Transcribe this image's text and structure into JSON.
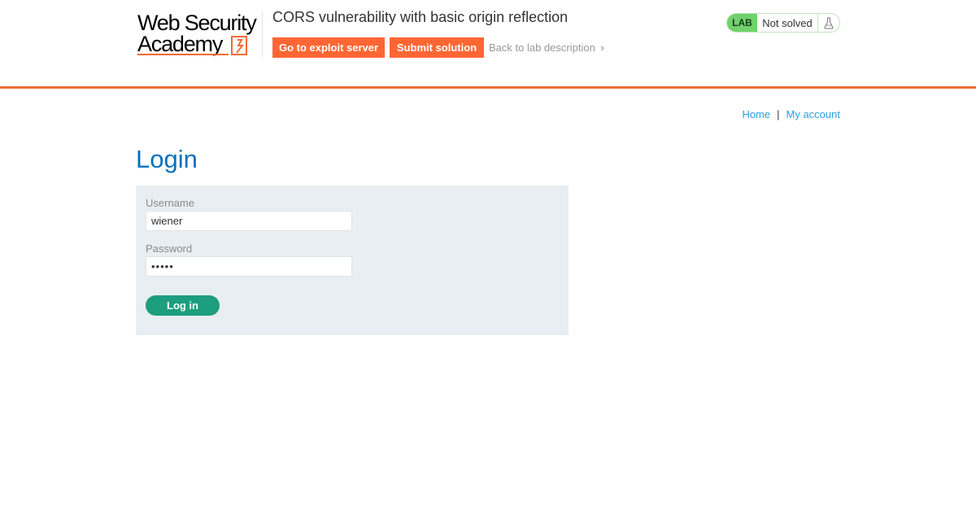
{
  "header": {
    "logo": {
      "line1": "Web Security",
      "line2": "Academy"
    },
    "lab_title": "CORS vulnerability with basic origin reflection",
    "exploit_button": "Go to exploit server",
    "submit_button": "Submit solution",
    "back_link": "Back to lab description",
    "back_link_icon": "double-chevron-right-icon",
    "status": {
      "badge": "LAB",
      "text": "Not solved",
      "icon": "flask-icon"
    },
    "colors": {
      "accent": "#ff6633",
      "status_green": "#70d16d"
    }
  },
  "nav": {
    "home": "Home",
    "separator": "|",
    "my_account": "My account"
  },
  "main": {
    "title": "Login",
    "form": {
      "username_label": "Username",
      "username_value": "wiener",
      "password_label": "Password",
      "password_value": "peter",
      "login_button": "Log in"
    },
    "colors": {
      "title": "#0071bc",
      "button": "#1c9e7f",
      "panel": "#e8eef1"
    }
  }
}
